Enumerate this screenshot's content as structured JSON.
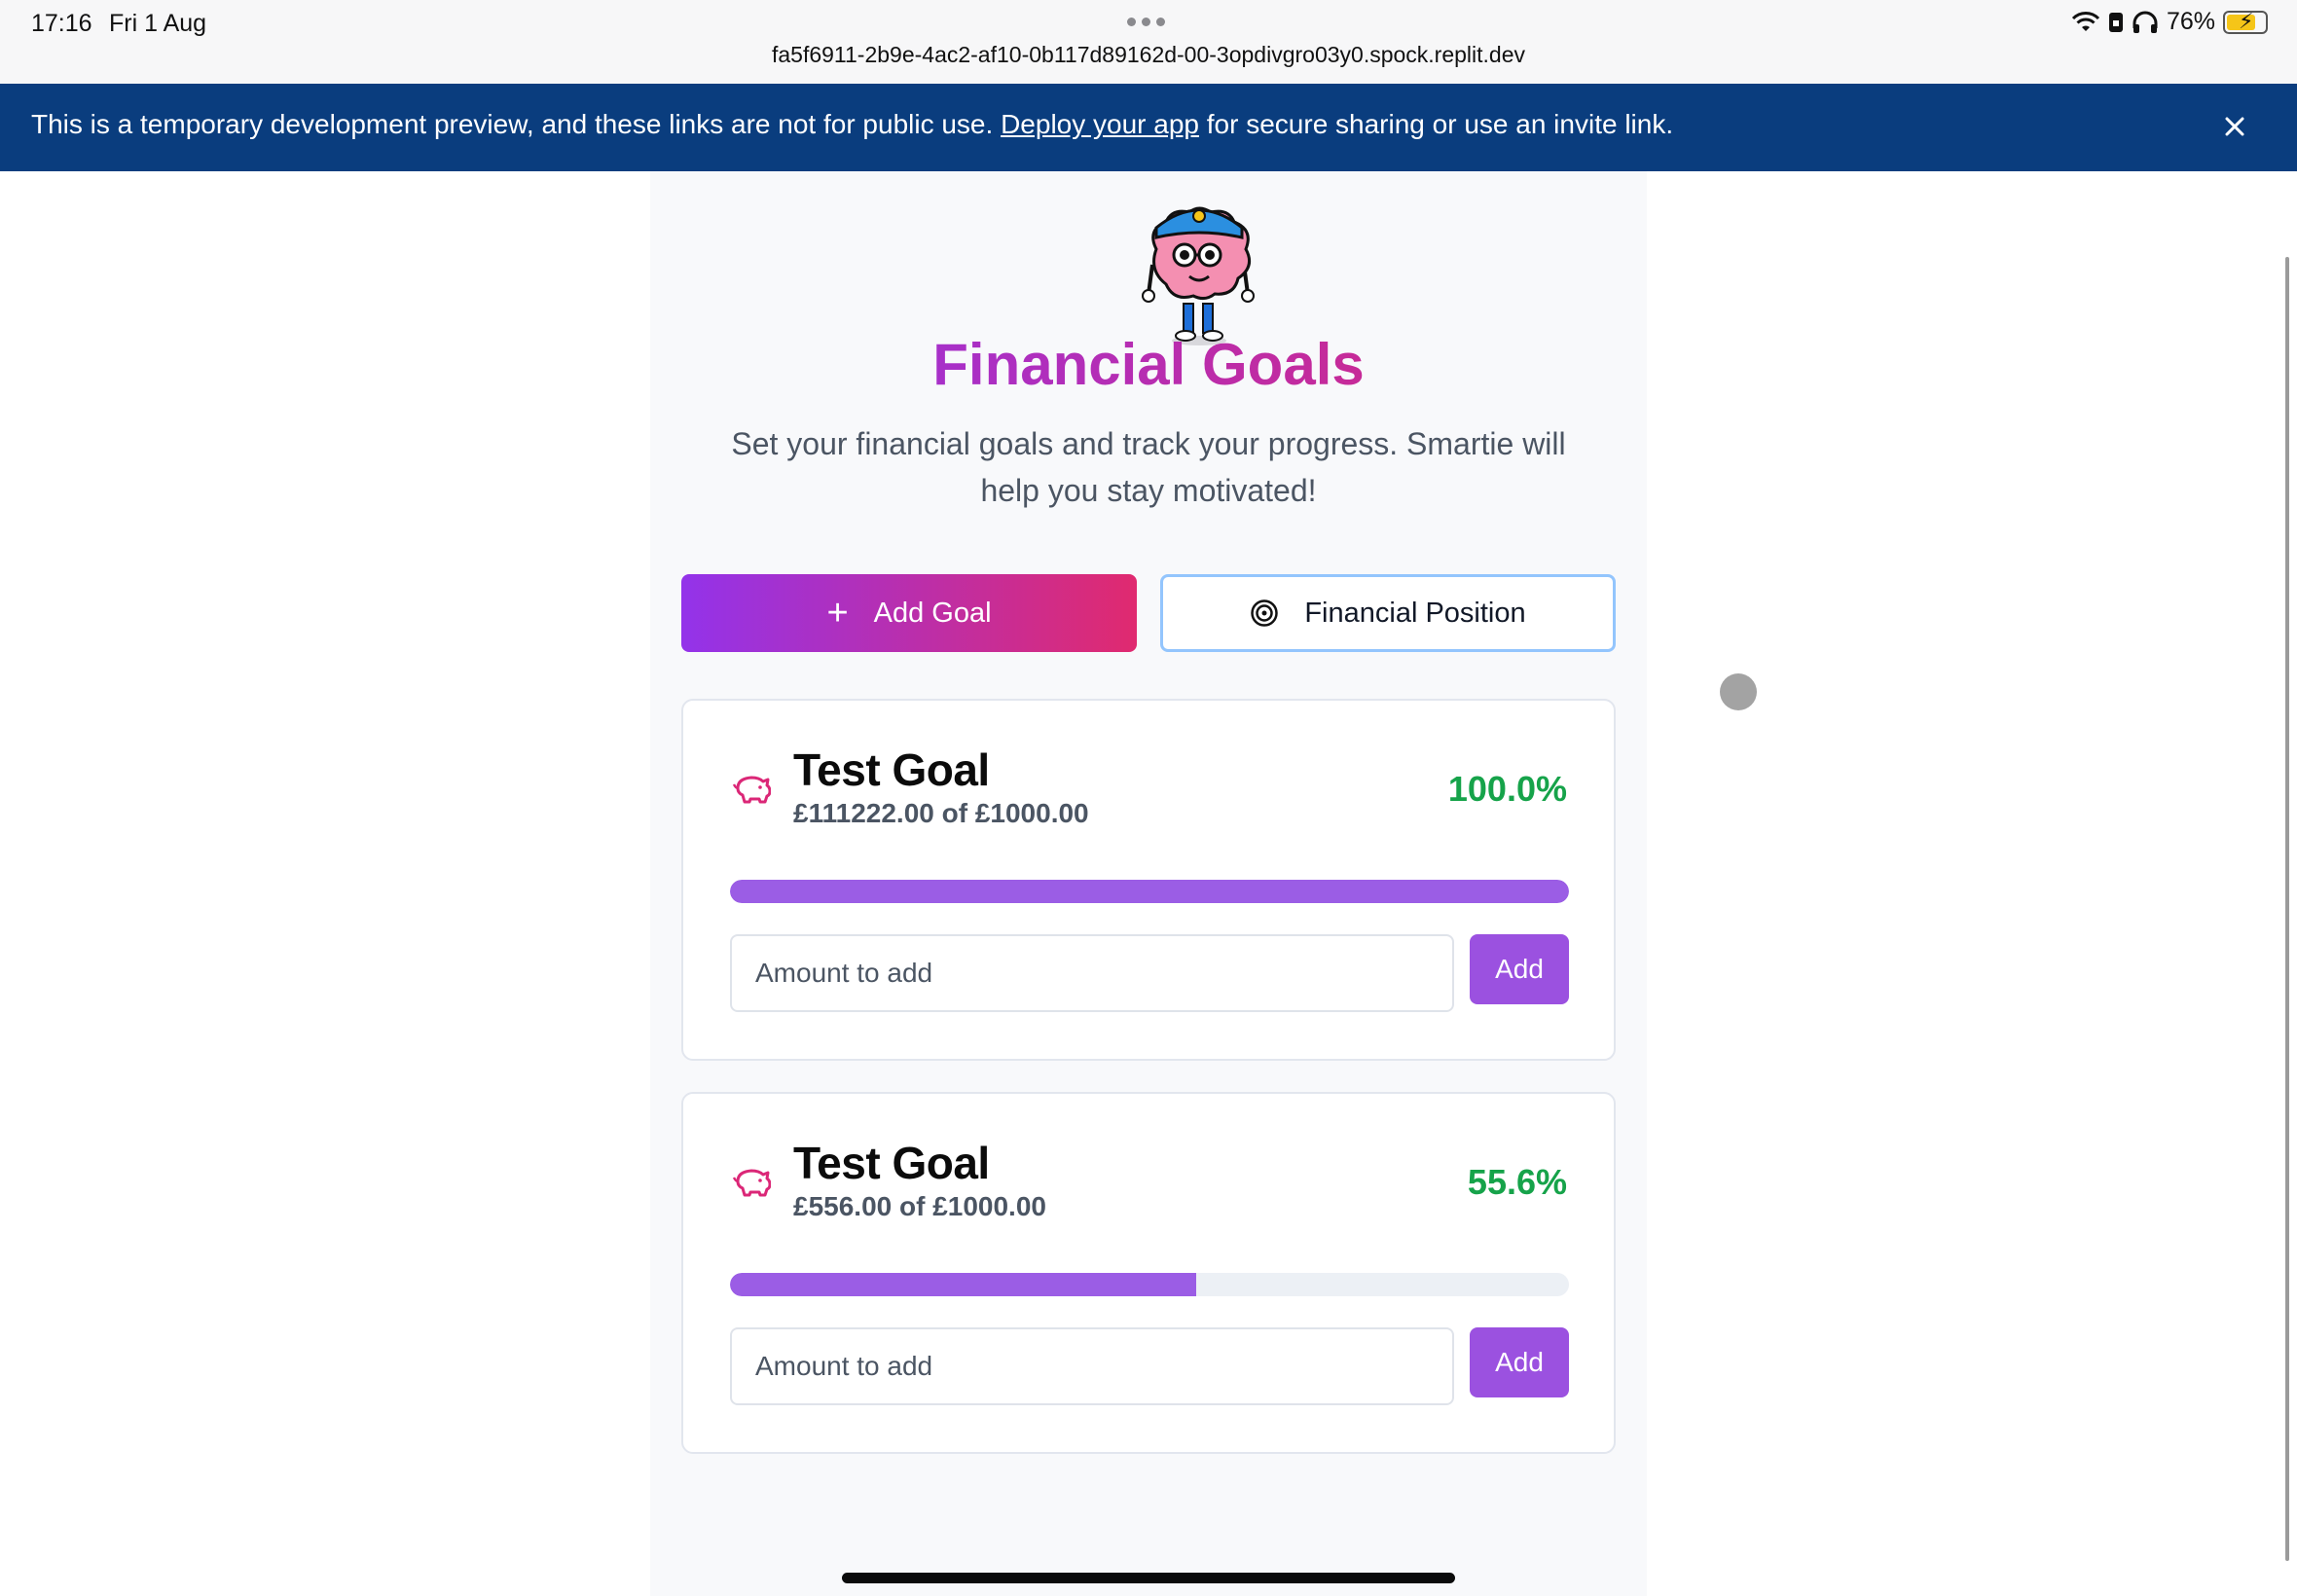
{
  "status_bar": {
    "time": "17:16",
    "date": "Fri 1 Aug",
    "url": "fa5f6911-2b9e-4ac2-af10-0b117d89162d-00-3opdivgro03y0.spock.replit.dev",
    "battery": "76%"
  },
  "banner": {
    "text_before": "This is a temporary development preview, and these links are not for public use. ",
    "link": "Deploy your app",
    "text_after": " for secure sharing or use an invite link."
  },
  "page": {
    "title": "Financial Goals",
    "subtitle": "Set your financial goals and track your progress. Smartie will help you stay motivated!"
  },
  "actions": {
    "add_goal_label": "Add Goal",
    "financial_position_label": "Financial Position"
  },
  "goals": [
    {
      "name": "Test Goal",
      "amount_text": "£111222.00 of £1000.00",
      "percent_text": "100.0%",
      "progress": 1.0,
      "input_placeholder": "Amount to add",
      "add_label": "Add"
    },
    {
      "name": "Test Goal",
      "amount_text": "£556.00 of £1000.00",
      "percent_text": "55.6%",
      "progress": 0.556,
      "input_placeholder": "Amount to add",
      "add_label": "Add"
    }
  ],
  "colors": {
    "accent_purple": "#9333ea",
    "accent_pink": "#db2777",
    "progress_fill": "#9b5de5",
    "percent_green": "#16a34a",
    "banner_blue": "#0a3d7e"
  },
  "icons": {
    "add_goal": "plus-icon",
    "financial_position": "target-icon",
    "goal": "piggy-bank-icon",
    "banner_close": "close-icon"
  }
}
